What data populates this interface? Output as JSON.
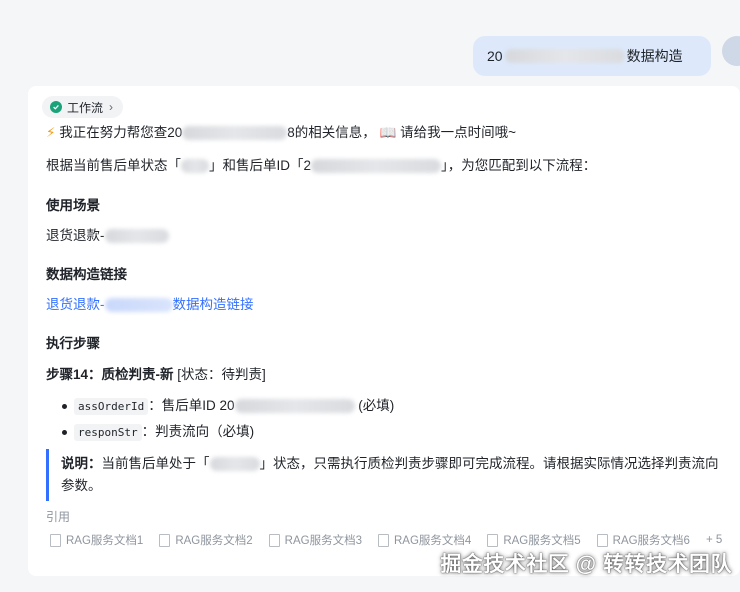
{
  "user_message": {
    "prefix": "20",
    "suffix": "数据构造"
  },
  "workflow": {
    "label": "工作流"
  },
  "intro": {
    "emoji": "⚡",
    "part1": "我正在努力帮您查20",
    "part2": "8的相关信息，",
    "book": "📖",
    "part3": "请给我一点时间哦~"
  },
  "match_line": {
    "part1": "根据当前售后单状态「",
    "part2": "」和售后单ID「2",
    "part3": "」，为您匹配到以下流程："
  },
  "scene": {
    "heading": "使用场景",
    "value": "退货退款-"
  },
  "link_section": {
    "heading": "数据构造链接",
    "link_prefix": "退货退款-",
    "link_suffix": "数据构造链接"
  },
  "steps": {
    "heading": "执行步骤",
    "step_title": "步骤14：质检判责-新",
    "step_status": "[状态：待判责]",
    "params": [
      {
        "code": "assOrderId",
        "text_prefix": "：售后单ID 20",
        "text_suffix": "(必填)"
      },
      {
        "code": "responStr",
        "text_prefix": "：判责流向（必填)",
        "text_suffix": ""
      }
    ]
  },
  "note": {
    "label": "说明：",
    "part1": "当前售后单处于「",
    "part2": "」状态，只需执行质检判责步骤即可完成流程。请根据实际情况选择判责流向参数。"
  },
  "references": {
    "label": "引用",
    "items": [
      "RAG服务文档1",
      "RAG服务文档2",
      "RAG服务文档3",
      "RAG服务文档4",
      "RAG服务文档5",
      "RAG服务文档6"
    ],
    "more": "+ 5"
  },
  "watermark": "掘金技术社区 @ 转转技术团队"
}
